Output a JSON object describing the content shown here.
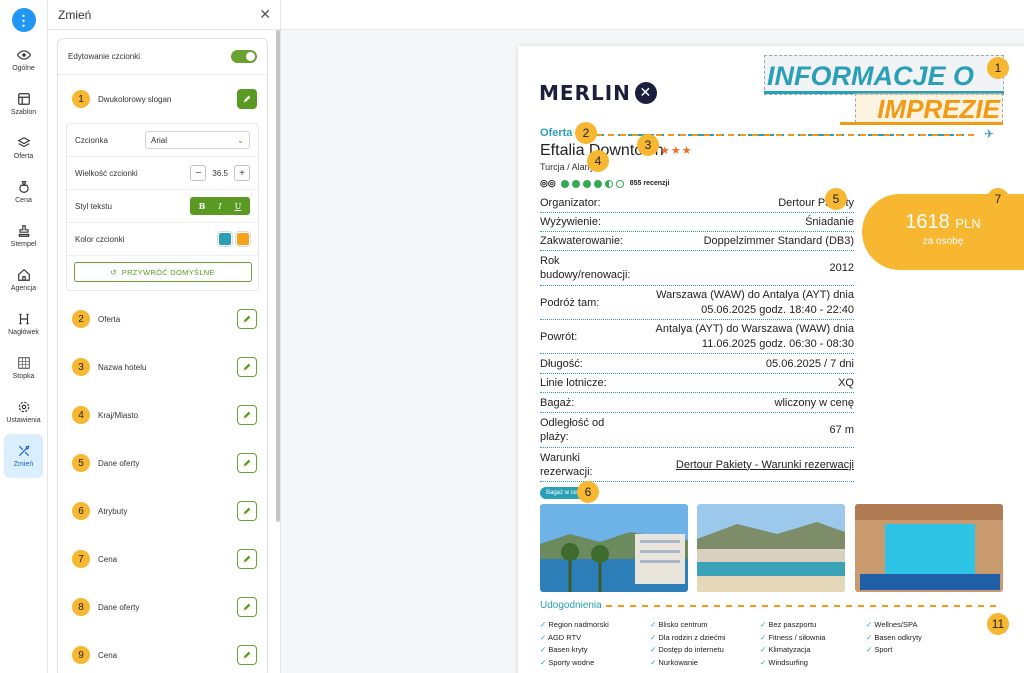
{
  "rail": {
    "items": [
      {
        "label": "Ogólne",
        "icon": "eye-icon"
      },
      {
        "label": "Szablon",
        "icon": "layout-icon"
      },
      {
        "label": "Oferta",
        "icon": "layers-icon"
      },
      {
        "label": "Cena",
        "icon": "money-bag-icon"
      },
      {
        "label": "Stempel",
        "icon": "stamp-icon"
      },
      {
        "label": "Agencja",
        "icon": "home-icon"
      },
      {
        "label": "Nagłówek",
        "icon": "heading-icon"
      },
      {
        "label": "Stopka",
        "icon": "footer-icon"
      },
      {
        "label": "Ustawienia",
        "icon": "gear-icon"
      },
      {
        "label": "Zmień",
        "icon": "tools-icon"
      }
    ]
  },
  "panel": {
    "title": "Zmień",
    "font_edit_label": "Edytowanie czcionki",
    "items": [
      {
        "num": "1",
        "label": "Dwukolorowy slogan"
      },
      {
        "num": "2",
        "label": "Oferta"
      },
      {
        "num": "3",
        "label": "Nazwa hotelu"
      },
      {
        "num": "4",
        "label": "Kraj/Miasto"
      },
      {
        "num": "5",
        "label": "Dane oferty"
      },
      {
        "num": "6",
        "label": "Atrybuty"
      },
      {
        "num": "7",
        "label": "Cena"
      },
      {
        "num": "8",
        "label": "Dane oferty"
      },
      {
        "num": "9",
        "label": "Cena"
      }
    ],
    "font": {
      "font_label": "Czcionka",
      "font_value": "Arial",
      "size_label": "Wielkość czcionki",
      "size_value": "36.5",
      "style_label": "Styl tekstu",
      "style_buttons": [
        "B",
        "I",
        "U"
      ],
      "color_label": "Kolor czcionki",
      "colors": [
        "#2aa0b7",
        "#f7a21b"
      ],
      "reset_label": "PRZYWRÓĆ DOMYŚLNE"
    }
  },
  "preview": {
    "logo": "MERLIN",
    "slogan_line1": "INFORMACJE O",
    "slogan_line2": "IMPREZIE",
    "section_offer": "Oferta",
    "hotel_name": "Eftalia Downtown",
    "stars": "★★★",
    "location": "Turcja / Alanya",
    "reviews": "855 recenzji",
    "details": [
      {
        "key": "Organizator:",
        "value": "Dertour Pakiety"
      },
      {
        "key": "Wyżywienie:",
        "value": "Śniadanie"
      },
      {
        "key": "Zakwaterowanie:",
        "value": "Doppelzimmer Standard (DB3)"
      },
      {
        "key": "Rok budowy/renowacji:",
        "value": "2012"
      },
      {
        "key": "Podróż tam:",
        "value": "Warszawa (WAW) do Antalya (AYT) dnia 05.06.2025 godz. 18:40 - 22:40"
      },
      {
        "key": "Powrót:",
        "value": "Antalya (AYT) do Warszawa (WAW) dnia 11.06.2025 godz. 06:30 - 08:30"
      },
      {
        "key": "Długość:",
        "value": "05.06.2025 / 7 dni"
      },
      {
        "key": "Linie lotnicze:",
        "value": "XQ"
      },
      {
        "key": "Bagaż:",
        "value": "wliczony w cenę"
      },
      {
        "key": "Odległość od plaży:",
        "value": "67 m"
      },
      {
        "key": "Warunki rezerwacji:",
        "value": "Dertour Pakiety - Warunki rezerwacji"
      }
    ],
    "price": {
      "value": "1618",
      "currency": "PLN",
      "sub": "za osobę"
    },
    "bagaz_pill": "Bagaż w cenie",
    "amenities_title": "Udogodnienia",
    "amenities_cols": [
      [
        "Region nadmorski",
        "AGD RTV",
        "Basen kryty",
        "Sporty wodne"
      ],
      [
        "Blisko centrum",
        "Dla rodzin z dziećmi",
        "Dostęp do internetu",
        "Nurkowanie"
      ],
      [
        "Bez paszportu",
        "Fitness / siłownia",
        "Klimatyzacja",
        "Windsurfing"
      ],
      [
        "Wellnes/SPA",
        "Basen odkryty",
        "Sport"
      ]
    ],
    "badges": [
      "1",
      "1",
      "2",
      "3",
      "4",
      "5",
      "6",
      "7",
      "11"
    ]
  }
}
